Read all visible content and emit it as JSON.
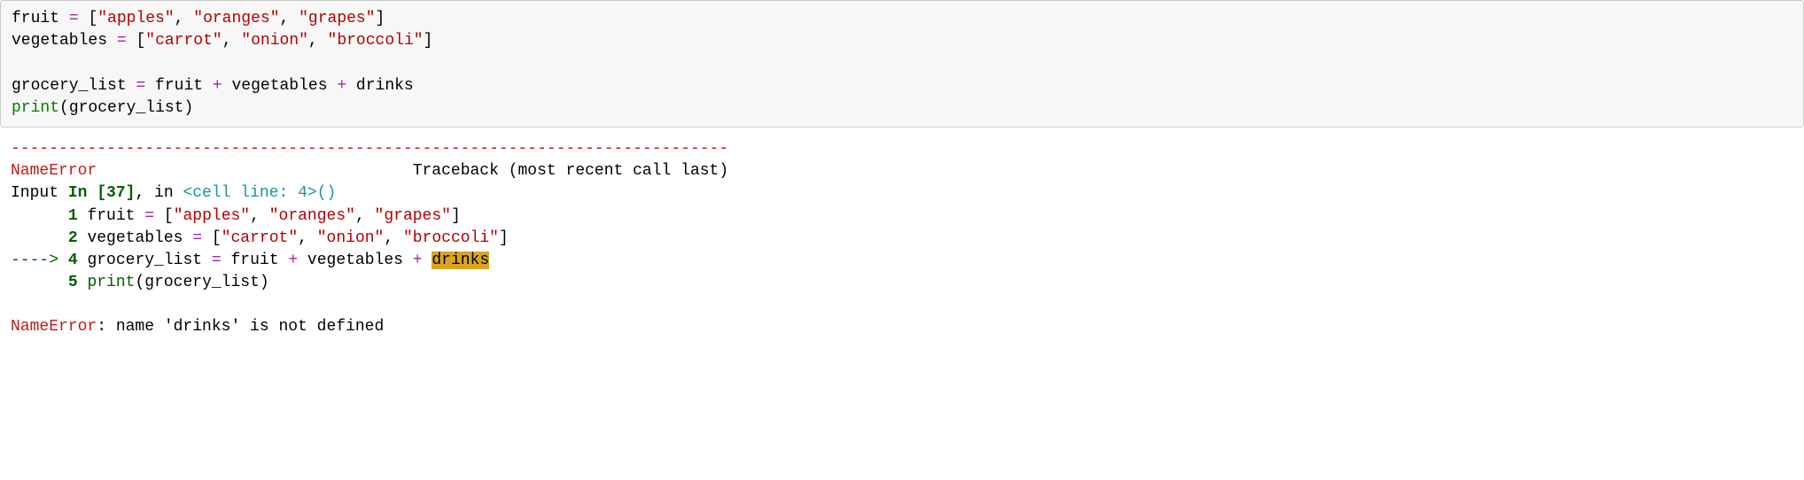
{
  "code": {
    "line1": {
      "var": "fruit ",
      "eq": "=",
      "sp": " ",
      "lb": "[",
      "s1": "\"apples\"",
      "c1": ", ",
      "s2": "\"oranges\"",
      "c2": ", ",
      "s3": "\"grapes\"",
      "rb": "]"
    },
    "line2": {
      "var": "vegetables ",
      "eq": "=",
      "sp": " ",
      "lb": "[",
      "s1": "\"carrot\"",
      "c1": ", ",
      "s2": "\"onion\"",
      "c2": ", ",
      "s3": "\"broccoli\"",
      "rb": "]"
    },
    "line4": {
      "var": "grocery_list ",
      "eq": "=",
      "sp1": " fruit ",
      "plus1": "+",
      "sp2": " vegetables ",
      "plus2": "+",
      "sp3": " drinks"
    },
    "line5": {
      "fn": "print",
      "lp": "(",
      "arg": "grocery_list",
      "rp": ")"
    }
  },
  "output": {
    "dashes": "---------------------------------------------------------------------------",
    "err_header": {
      "name": "NameError",
      "spacer": "                                 ",
      "trace": "Traceback (most recent call last)"
    },
    "input_line": {
      "prefix": "Input ",
      "in_label": "In [37]",
      "comma": ", in ",
      "cell": "<cell line: 4>",
      "parens": "()"
    },
    "tb1": {
      "indent": "      ",
      "num": "1",
      "sp": " ",
      "var": "fruit ",
      "eq": "=",
      "sp2": " ",
      "lb": "[",
      "s1": "\"apples\"",
      "c1": ", ",
      "s2": "\"oranges\"",
      "c2": ", ",
      "s3": "\"grapes\"",
      "rb": "]"
    },
    "tb2": {
      "indent": "      ",
      "num": "2",
      "sp": " ",
      "var": "vegetables ",
      "eq": "=",
      "sp2": " ",
      "lb": "[",
      "s1": "\"carrot\"",
      "c1": ", ",
      "s2": "\"onion\"",
      "c2": ", ",
      "s3": "\"broccoli\"",
      "rb": "]"
    },
    "tb4": {
      "arrow": "----> ",
      "num": "4",
      "sp": " ",
      "var": "grocery_list ",
      "eq": "=",
      "sp1": " fruit ",
      "plus1": "+",
      "sp2": " vegetables ",
      "plus2": "+",
      "sp3": " ",
      "hl": "drinks"
    },
    "tb5": {
      "indent": "      ",
      "num": "5",
      "sp": " ",
      "fn": "print",
      "lp": "(",
      "arg": "grocery_list",
      "rp": ")"
    },
    "final": {
      "name": "NameError",
      "msg": ": name 'drinks' is not defined"
    }
  }
}
